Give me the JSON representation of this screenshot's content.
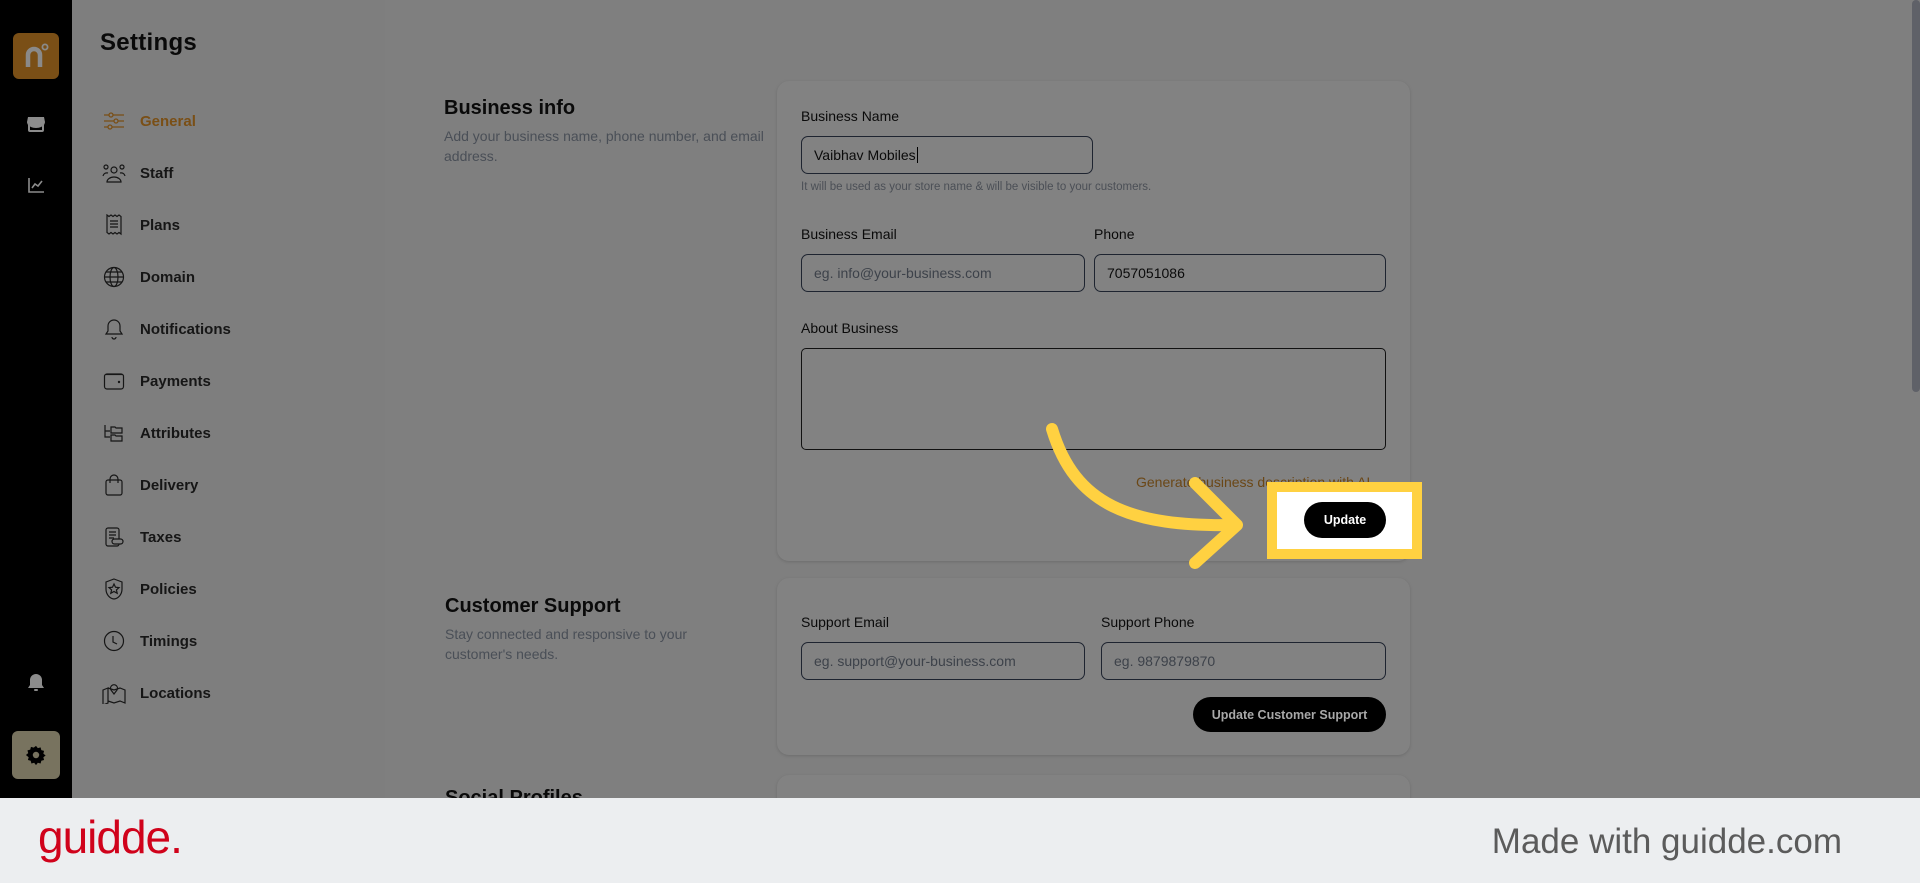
{
  "rail": {
    "logo_letter": "n",
    "items": [
      {
        "name": "store-icon"
      },
      {
        "name": "analytics-icon"
      }
    ],
    "bottom": [
      {
        "name": "bell-icon"
      },
      {
        "name": "settings-gear-icon",
        "active": true
      }
    ]
  },
  "sidebar": {
    "title": "Settings",
    "items": [
      {
        "label": "General",
        "icon": "sliders-icon",
        "active": true
      },
      {
        "label": "Staff",
        "icon": "users-icon"
      },
      {
        "label": "Plans",
        "icon": "receipt-icon"
      },
      {
        "label": "Domain",
        "icon": "globe-icon"
      },
      {
        "label": "Notifications",
        "icon": "bell-icon"
      },
      {
        "label": "Payments",
        "icon": "wallet-icon"
      },
      {
        "label": "Attributes",
        "icon": "folder-tree-icon"
      },
      {
        "label": "Delivery",
        "icon": "shopping-bag-icon"
      },
      {
        "label": "Taxes",
        "icon": "tax-document-icon"
      },
      {
        "label": "Policies",
        "icon": "shield-star-icon"
      },
      {
        "label": "Timings",
        "icon": "clock-icon"
      },
      {
        "label": "Locations",
        "icon": "map-pin-icon"
      }
    ]
  },
  "business_info": {
    "title": "Business info",
    "description": "Add your business name, phone number, and email address.",
    "name_label": "Business Name",
    "name_value": "Vaibhav Mobiles",
    "name_hint": "It will be used as your store name & will be visible to your customers.",
    "email_label": "Business Email",
    "email_placeholder": "eg. info@your-business.com",
    "phone_label": "Phone",
    "phone_value": "7057051086",
    "about_label": "About Business",
    "about_value": "",
    "ai_link": "Generate business description with AI",
    "update_button": "Update"
  },
  "customer_support": {
    "title": "Customer Support",
    "description": "Stay connected and responsive to your customer's needs.",
    "email_label": "Support Email",
    "email_placeholder": "eg. support@your-business.com",
    "phone_label": "Support Phone",
    "phone_placeholder": "eg. 9879879870",
    "update_button": "Update Customer Support"
  },
  "social_profiles": {
    "title": "Social Profiles"
  },
  "colors": {
    "accent": "#7a4f16",
    "highlight": "#ffd141",
    "guidde_red": "#d0021b"
  },
  "footer": {
    "brand": "guidde.",
    "made_with": "Made with guidde.com"
  }
}
